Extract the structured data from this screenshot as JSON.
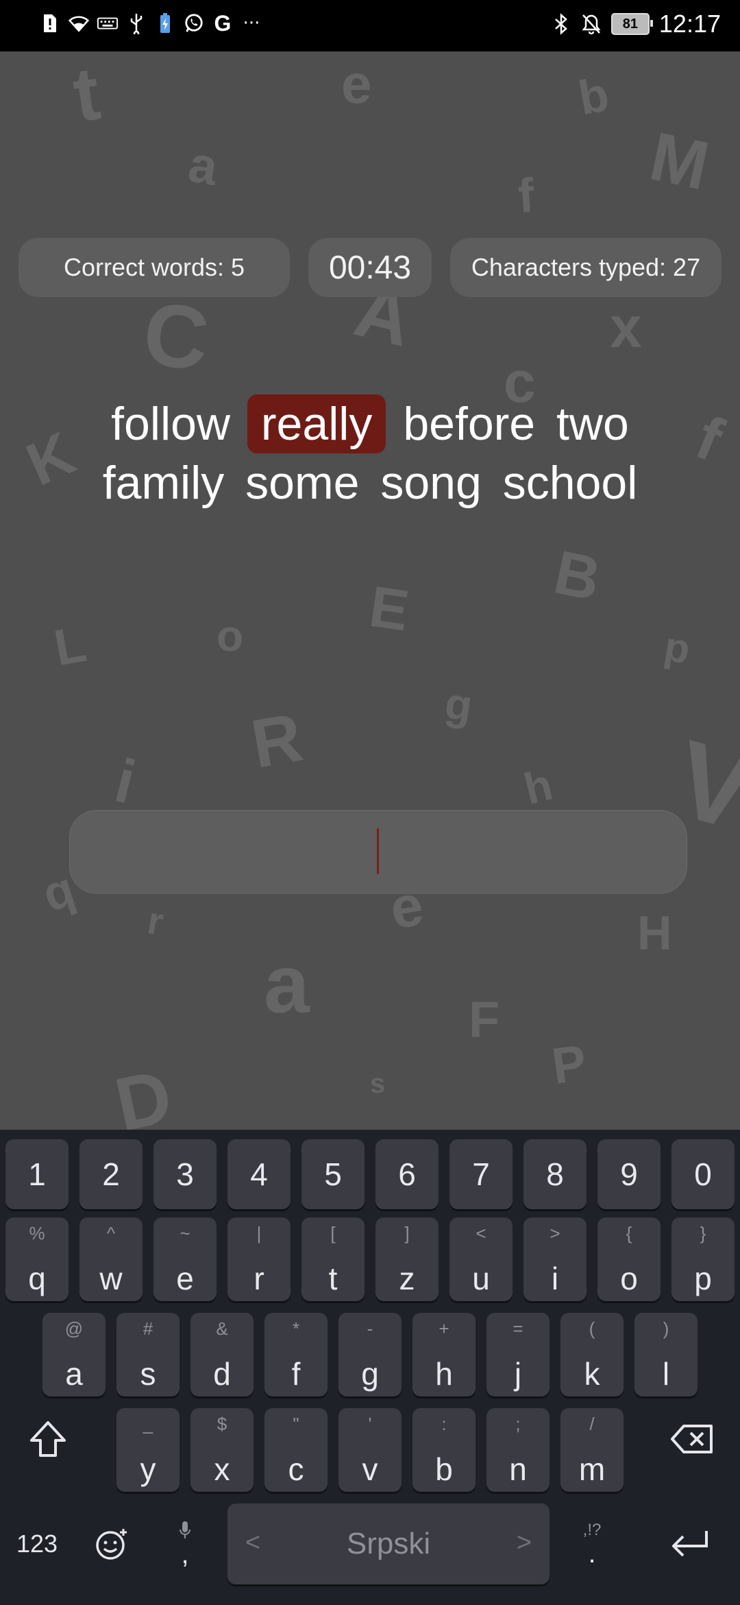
{
  "status_bar": {
    "time": "12:17",
    "battery": "81",
    "left_icons": [
      "alert-icon",
      "wifi-icon",
      "keyboard-icon",
      "usb-icon",
      "battery-saver-icon",
      "whatsapp-icon",
      "google-icon",
      "more-icon"
    ],
    "right_icons": [
      "bluetooth-icon",
      "mute-icon"
    ]
  },
  "stats": {
    "correct_words": "Correct words: 5",
    "timer": "00:43",
    "characters_typed": "Characters typed: 27"
  },
  "words": {
    "line1": [
      "follow",
      "really",
      "before",
      "two"
    ],
    "line2": [
      "family",
      "some",
      "song",
      "school"
    ],
    "current_word": "really",
    "current_color": "#6e1b16"
  },
  "input": {
    "value": ""
  },
  "keyboard": {
    "numbers": [
      "1",
      "2",
      "3",
      "4",
      "5",
      "6",
      "7",
      "8",
      "9",
      "0"
    ],
    "row1": [
      {
        "main": "q",
        "sub": "%"
      },
      {
        "main": "w",
        "sub": "^"
      },
      {
        "main": "e",
        "sub": "~"
      },
      {
        "main": "r",
        "sub": "|"
      },
      {
        "main": "t",
        "sub": "["
      },
      {
        "main": "z",
        "sub": "]"
      },
      {
        "main": "u",
        "sub": "<"
      },
      {
        "main": "i",
        "sub": ">"
      },
      {
        "main": "o",
        "sub": "{"
      },
      {
        "main": "p",
        "sub": "}"
      }
    ],
    "row2": [
      {
        "main": "a",
        "sub": "@"
      },
      {
        "main": "s",
        "sub": "#"
      },
      {
        "main": "d",
        "sub": "&"
      },
      {
        "main": "f",
        "sub": "*"
      },
      {
        "main": "g",
        "sub": "-"
      },
      {
        "main": "h",
        "sub": "+"
      },
      {
        "main": "j",
        "sub": "="
      },
      {
        "main": "k",
        "sub": "("
      },
      {
        "main": "l",
        "sub": ")"
      }
    ],
    "row3": [
      {
        "main": "y",
        "sub": "_"
      },
      {
        "main": "x",
        "sub": "$"
      },
      {
        "main": "c",
        "sub": "\""
      },
      {
        "main": "v",
        "sub": "'"
      },
      {
        "main": "b",
        "sub": ":"
      },
      {
        "main": "n",
        "sub": ";"
      },
      {
        "main": "m",
        "sub": "/"
      }
    ],
    "symbols_label": "123",
    "comma": ",",
    "period": ".",
    "period_hint": ",!?",
    "space_label": "Srpski"
  }
}
